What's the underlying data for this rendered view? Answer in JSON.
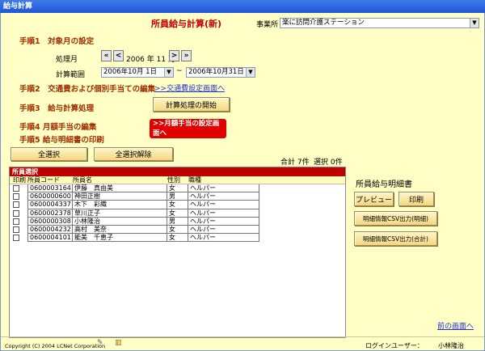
{
  "window": {
    "title": "給与計算"
  },
  "header": {
    "title": "所員給与計算(新)",
    "office_label": "事業所",
    "office_value": "楽に訪問介護ステーション"
  },
  "step1": {
    "heading": "手順1　対象月の設定",
    "month_label": "処理月",
    "first": "«",
    "prev": "<",
    "month_value": "2006 年 11 月",
    "next": ">",
    "last": "»",
    "range_label": "計算範囲",
    "range_start": "2006年10月 1日",
    "range_sep": "~",
    "range_end": "2006年10月31日"
  },
  "step2": {
    "heading": "手順2　交通費および個別手当ての編集",
    "link": ">>交通費設定画面へ"
  },
  "step3": {
    "heading": "手順3　給与計算処理",
    "button": "計算処理の開始"
  },
  "step4": {
    "heading": "手順4 月額手当の編集",
    "link": ">>月額手当の設定画面へ"
  },
  "step5": {
    "heading": "手順5 給与明細書の印刷",
    "select_all": "全選択",
    "deselect_all": "全選択解除",
    "total": "合計 7件",
    "selected": "選択 0件"
  },
  "grid": {
    "title": "所員選択",
    "columns": [
      "印刷",
      "所員コード",
      "所員名",
      "性別",
      "職種"
    ],
    "rows": [
      {
        "code": "0600003164",
        "name": "伊藤　真由美",
        "sex": "女",
        "job": "ヘルパー"
      },
      {
        "code": "0600000600",
        "name": "神田正樹",
        "sex": "男",
        "job": "ヘルパー"
      },
      {
        "code": "0600004337",
        "name": "木下　彩織",
        "sex": "女",
        "job": "ヘルパー"
      },
      {
        "code": "0600002378",
        "name": "草川正子",
        "sex": "女",
        "job": "ヘルパー"
      },
      {
        "code": "0600000308",
        "name": "小林隆治",
        "sex": "男",
        "job": "ヘルパー"
      },
      {
        "code": "0600004232",
        "name": "高村　美奈",
        "sex": "女",
        "job": "ヘルパー"
      },
      {
        "code": "0600004101",
        "name": "能美　千恵子",
        "sex": "女",
        "job": "ヘルパー"
      }
    ]
  },
  "payslip": {
    "heading": "所員給与明細書",
    "preview": "プレビュー",
    "print": "印刷",
    "csv_month": "明細情報CSV出力(明細)",
    "csv_total": "明細情報CSV出力(合計)"
  },
  "footer": {
    "back_link": "前の画面へ",
    "copyright": "Copyright (C) 2004 LCNet Corporation",
    "login_label": "ログインユーザー：",
    "login_user": "小林隆治"
  }
}
